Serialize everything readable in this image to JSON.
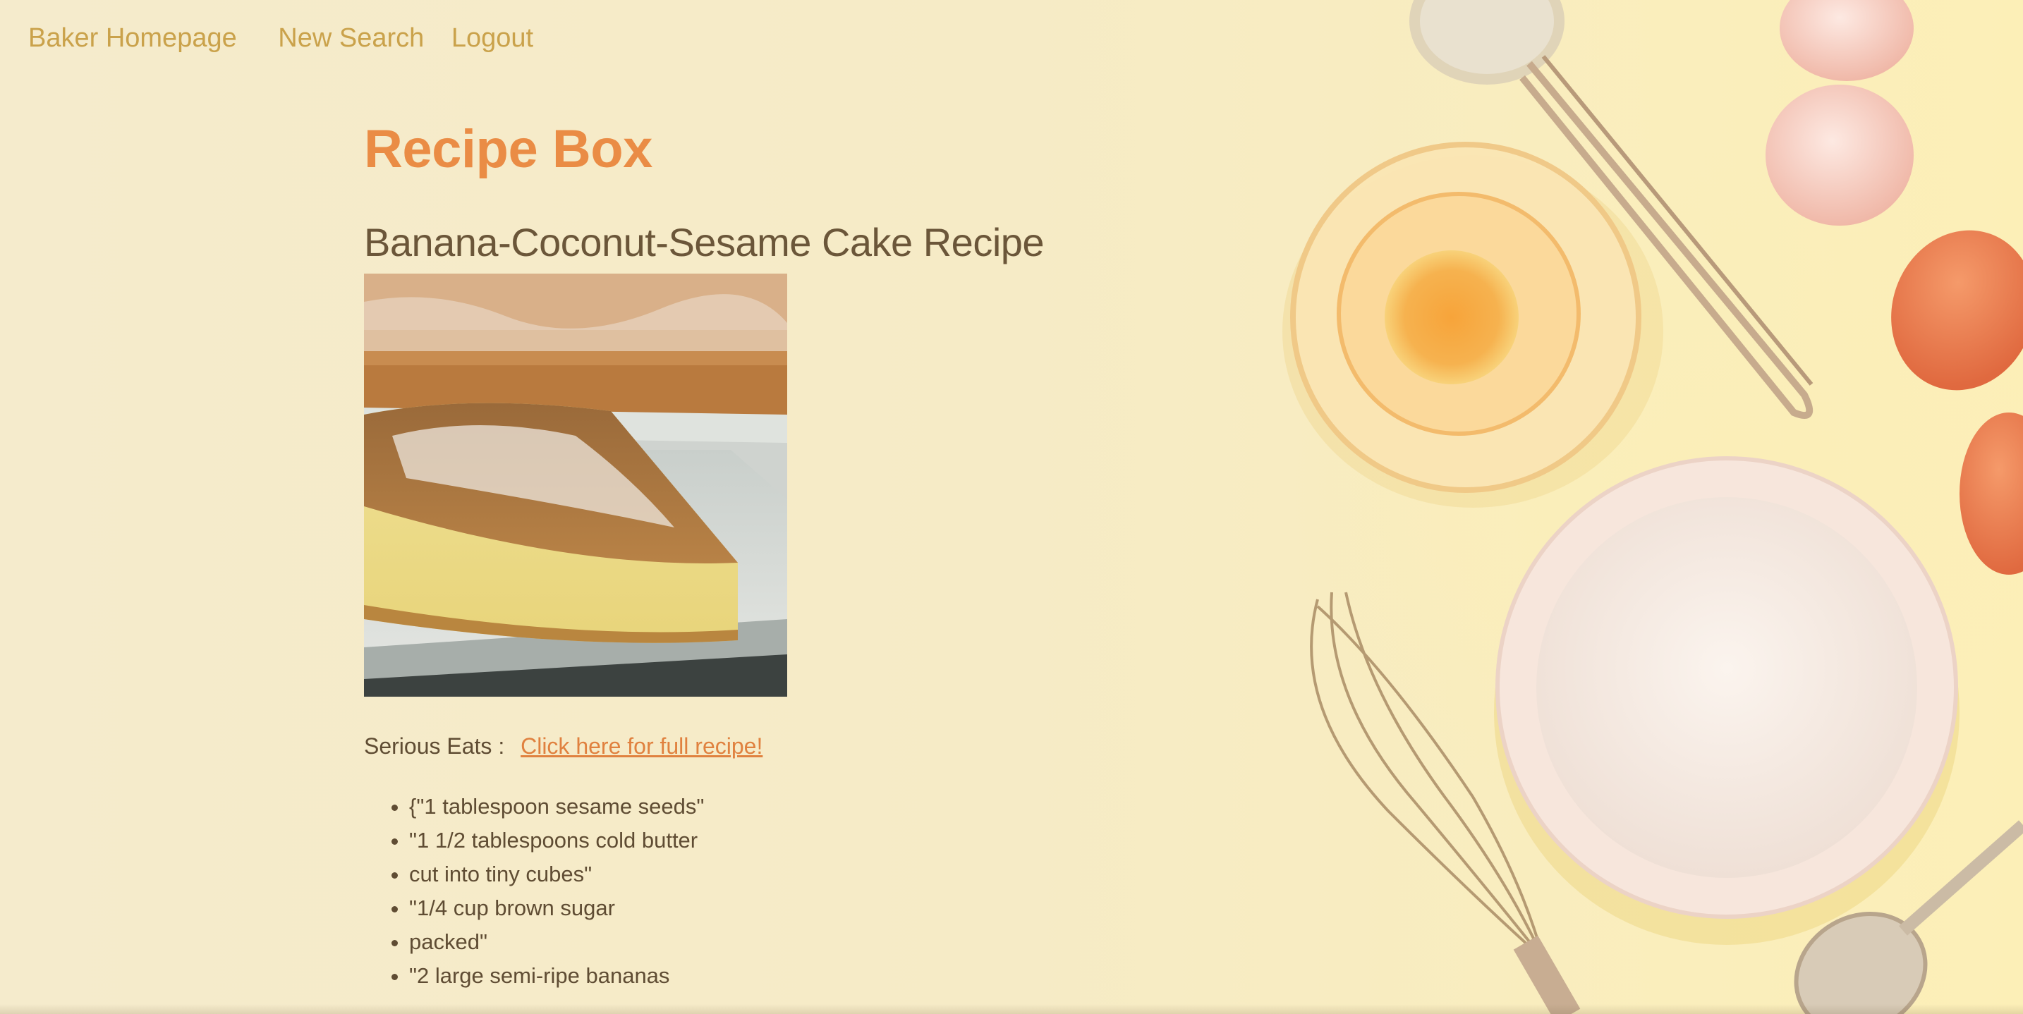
{
  "nav": {
    "home": "Baker Homepage",
    "new_search": "New Search",
    "logout": "Logout"
  },
  "page_title": "Recipe Box",
  "recipe": {
    "title": "Banana-Coconut-Sesame Cake Recipe",
    "source_label": "Serious Eats :",
    "link_text": "Click here for full recipe!",
    "ingredients": [
      "{\"1 tablespoon sesame seeds\"",
      "\"1 1/2 tablespoons cold butter",
      "cut into tiny cubes\"",
      "\"1/4 cup brown sugar",
      "packed\"",
      "\"2 large semi-ripe bananas"
    ]
  },
  "colors": {
    "background": "#f6ebc9",
    "nav_link": "#caa24b",
    "accent": "#ea8c45",
    "text": "#5f4c33"
  }
}
